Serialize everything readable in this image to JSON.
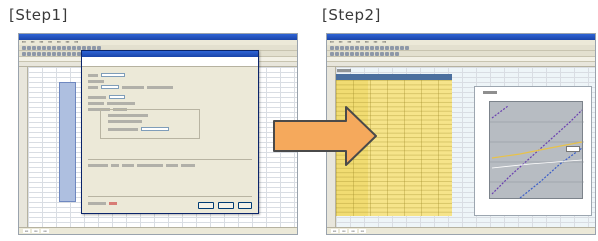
{
  "labels": {
    "step1": "[Step1]",
    "step2": "[Step2]"
  },
  "colors": {
    "arrow_fill": "#f5a95c",
    "arrow_stroke": "#4a4a4a",
    "table_fill": "#f6e48a",
    "dialog_title": "#1f4eb8",
    "plot_background": "#b7bcc2"
  },
  "icons": {
    "arrow": "right-arrow-icon"
  }
}
